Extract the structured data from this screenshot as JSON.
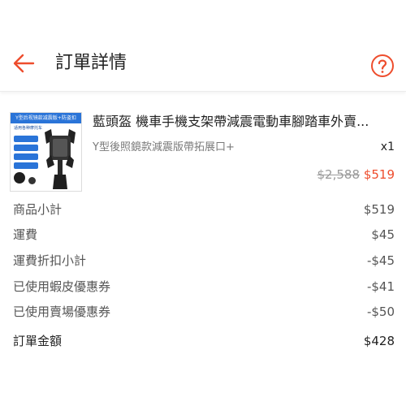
{
  "header": {
    "title": "訂單詳情",
    "back_icon": "arrow-left-icon",
    "help_icon": "question-circle-icon"
  },
  "product": {
    "name": "藍頭盔 機車手機支架帶減震電動車腳踏車外賣...",
    "variant": "Y型後照鏡款減震版帶拓展口+",
    "quantity": "x1",
    "original_price": "$2,588",
    "price": "$519",
    "thumbnail": {
      "banner": "Y型后视镜款减震版+防盗扣",
      "subtitle": "适用各种摩托车",
      "image_icon": "phone-holder-image"
    }
  },
  "summary": {
    "subtotal": {
      "label": "商品小計",
      "value": "$519"
    },
    "shipping": {
      "label": "運費",
      "value": "$45"
    },
    "shipping_discount": {
      "label": "運費折扣小計",
      "value": "-$45"
    },
    "shopee_voucher": {
      "label": "已使用蝦皮優惠券",
      "value": "-$41"
    },
    "seller_voucher": {
      "label": "已使用賣場優惠券",
      "value": "-$50"
    },
    "total": {
      "label": "訂單金額",
      "value": "$428"
    }
  },
  "colors": {
    "accent": "#ee4d2d",
    "thumb_blue": "#2a74d8"
  }
}
